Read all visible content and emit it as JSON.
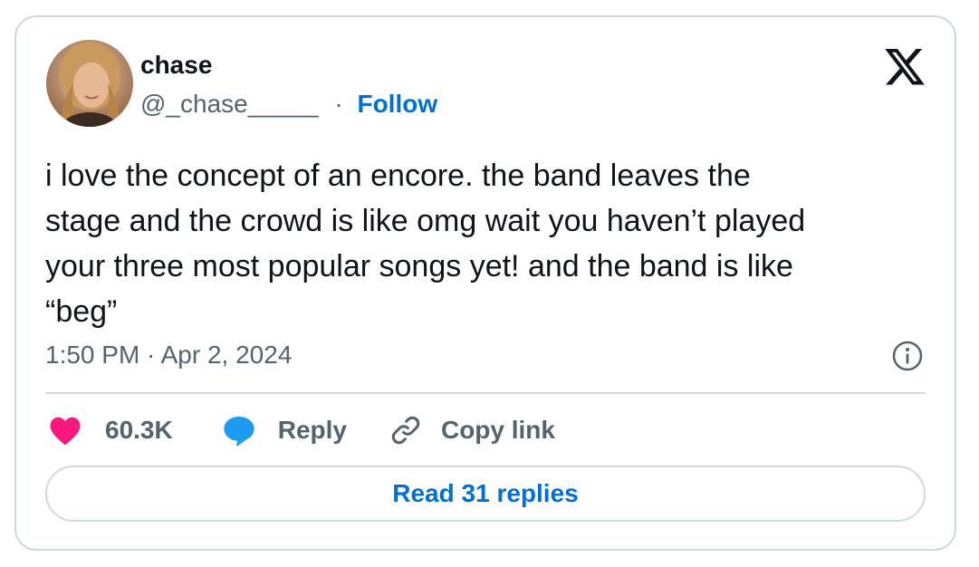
{
  "author": {
    "name": "chase",
    "handle": "@_chase_____",
    "separator": "·",
    "follow_label": "Follow",
    "avatar_icon": "avatar-photo"
  },
  "platform_icon": "x-logo-icon",
  "tweet": {
    "text": "i love the concept of an encore. the band leaves the\nstage and the crowd is like omg wait you haven’t played\nyour three most popular songs yet! and the band is like\n“beg”",
    "timestamp": "1:50 PM · Apr 2, 2024"
  },
  "actions": {
    "like_count": "60.3K",
    "reply_label": "Reply",
    "copy_link_label": "Copy link"
  },
  "read_replies_label": "Read 31 replies",
  "colors": {
    "link_blue": "#006fd6",
    "like_pink": "#f91880",
    "reply_blue": "#1d9bf0",
    "secondary_text": "#536471",
    "border": "#cfd9de"
  }
}
